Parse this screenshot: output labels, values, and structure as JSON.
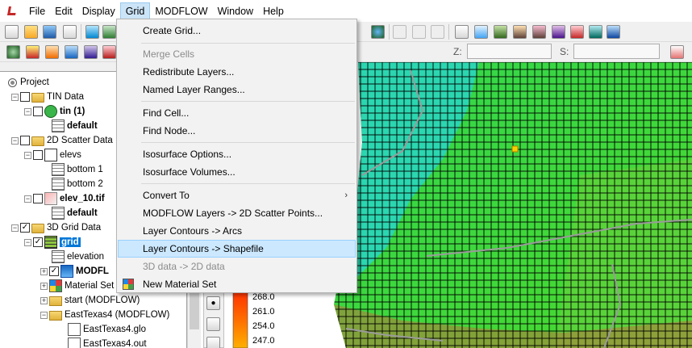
{
  "menubar": {
    "items": [
      "File",
      "Edit",
      "Display",
      "Grid",
      "MODFLOW",
      "Window",
      "Help"
    ],
    "active": "Grid"
  },
  "toolbar": {
    "z_label": "Z:",
    "s_label": "S:"
  },
  "grid_menu": {
    "items": [
      {
        "label": "Create Grid...",
        "enabled": true
      },
      {
        "label": "Merge Cells",
        "enabled": false
      },
      {
        "label": "Redistribute Layers...",
        "enabled": true
      },
      {
        "label": "Named Layer Ranges...",
        "enabled": true
      },
      {
        "label": "Find Cell...",
        "enabled": true
      },
      {
        "label": "Find Node...",
        "enabled": true
      },
      {
        "label": "Isosurface Options...",
        "enabled": true
      },
      {
        "label": "Isosurface Volumes...",
        "enabled": true
      },
      {
        "label": "Convert To",
        "enabled": true,
        "submenu": true
      },
      {
        "label": "MODFLOW Layers -> 2D Scatter Points...",
        "enabled": true
      },
      {
        "label": "Layer Contours -> Arcs",
        "enabled": true
      },
      {
        "label": "Layer Contours -> Shapefile",
        "enabled": true,
        "highlighted": true
      },
      {
        "label": "3D data -> 2D data",
        "enabled": false
      },
      {
        "label": "New Material Set",
        "enabled": true
      }
    ]
  },
  "project_tree": {
    "root": "Project",
    "tin_data": "TIN Data",
    "tin": "tin (1)",
    "tin_default": "default",
    "scatter_data": "2D Scatter Data",
    "elevs": "elevs",
    "bottom1": "bottom 1",
    "bottom2": "bottom 2",
    "elev10": "elev_10.tif",
    "elev_default": "default",
    "grid_data": "3D Grid Data",
    "grid": "grid",
    "elevation": "elevation",
    "modflow": "MODFL",
    "material_set": "Material Set",
    "start": "start (MODFLOW)",
    "easttexas": "EastTexas4 (MODFLOW)",
    "glo": "EastTexas4.glo",
    "out": "EastTexas4.out"
  },
  "legend": {
    "values": [
      "268.0",
      "261.0",
      "254.0",
      "247.0"
    ]
  },
  "colors": {
    "menu_highlight": "#cce8ff",
    "selection": "#0078d7",
    "grid_green": "#33cc33",
    "grid_teal": "#2bd6b0"
  }
}
